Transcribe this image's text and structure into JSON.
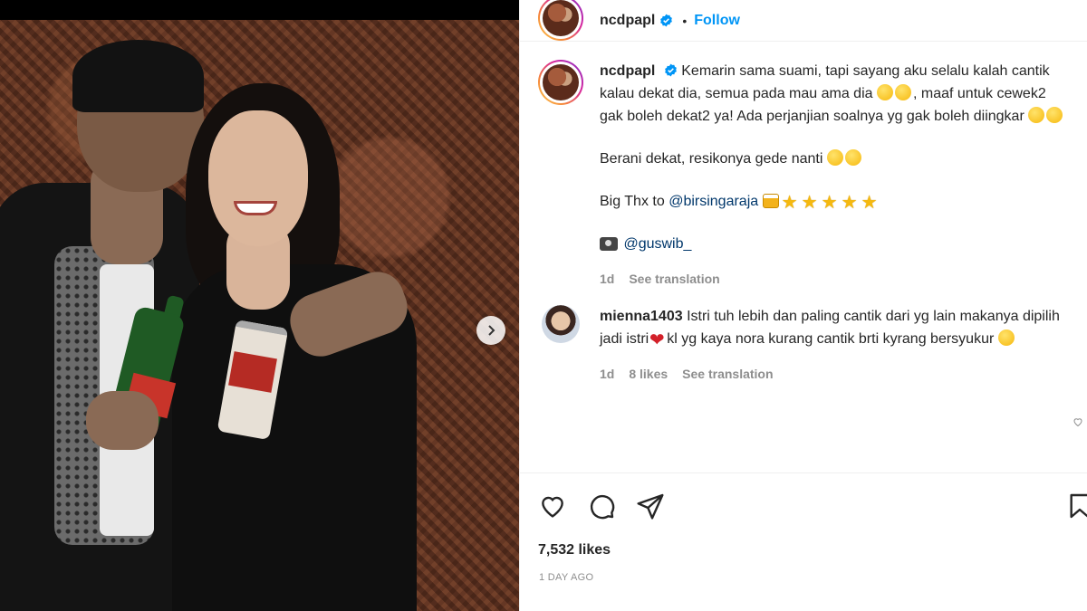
{
  "post": {
    "username": "ncdpapl",
    "separator": "•",
    "follow_label": "Follow"
  },
  "caption": {
    "username": "ncdpapl",
    "line1": "Kemarin sama suami, tapi sayang aku selalu kalah cantik kalau dekat dia, semua pada mau ama dia",
    "line1_tail": ", maaf untuk cewek2 gak boleh dekat2 ya! Ada perjanjian soalnya yg gak boleh diingkar",
    "para2": "Berani dekat, resikonya gede nanti",
    "para3_prefix": "Big Thx to",
    "para3_mention": "@birsingaraja",
    "para4_mention": "@guswib_",
    "time": "1d",
    "see_translation": "See translation"
  },
  "comment": {
    "username": "mienna1403",
    "text_a": "Istri tuh lebih dan paling cantik dari yg lain makanya dipilih jadi istri",
    "text_b": "kl yg kaya nora kurang cantik brti kyrang bersyukur",
    "time": "1d",
    "likes": "8 likes",
    "see_translation": "See translation"
  },
  "stats": {
    "likes": "7,532 likes",
    "posted": "1 DAY AGO"
  },
  "icons": [
    "heart-icon",
    "comment-icon",
    "share-icon",
    "bookmark-icon",
    "verified-icon",
    "chevron-right-icon"
  ],
  "colors": {
    "accent": "#0095f6",
    "mention": "#00376b",
    "muted": "#8e8e8e",
    "text": "#262626"
  }
}
